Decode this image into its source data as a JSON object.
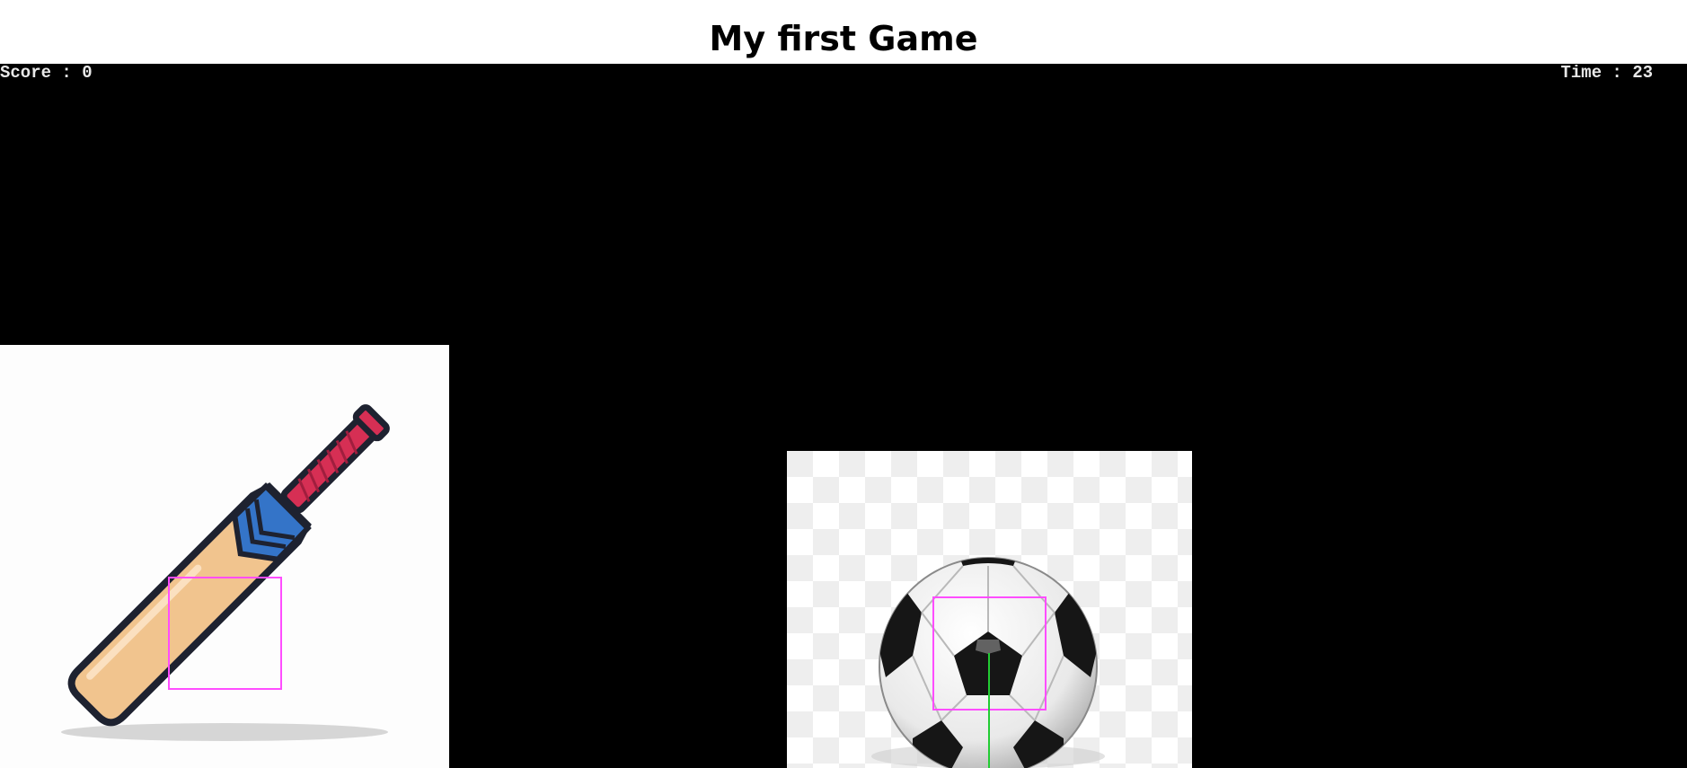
{
  "page": {
    "title": "My first Game"
  },
  "hud": {
    "score_label": "Score : ",
    "score_value": "0",
    "time_label": "Time : ",
    "time_value": "23"
  },
  "colors": {
    "canvas_background": "#000000",
    "hud_text": "#e8e8e8",
    "hitbox": "#ff4dff",
    "velocity_line": "#22cc33"
  },
  "sprites": {
    "bat": {
      "icon": "cricket-bat-icon"
    },
    "ball": {
      "icon": "soccer-ball-icon"
    }
  }
}
